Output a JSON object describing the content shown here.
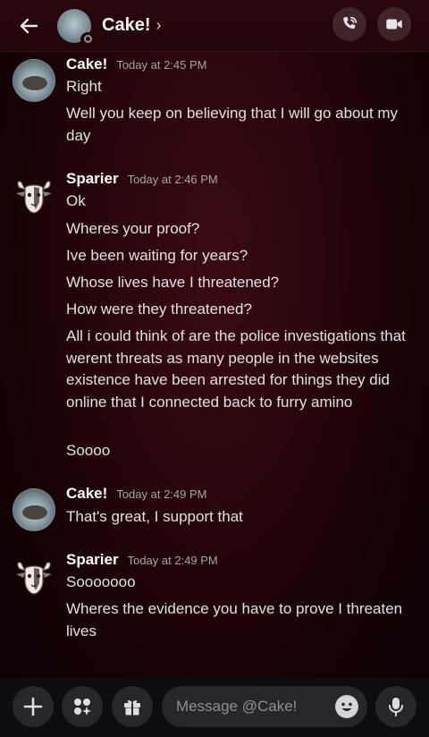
{
  "header": {
    "title": "Cake!",
    "chevron": "›",
    "back_icon": "arrow-left-icon",
    "call_icon": "phone-call-icon",
    "video_icon": "video-camera-icon"
  },
  "messages": [
    {
      "author": "Cake!",
      "time": "Today at 2:45 PM",
      "avatar": "cake",
      "lines": [
        "Right",
        "Well you keep on believing that I will go about my day"
      ]
    },
    {
      "author": "Sparier",
      "time": "Today at 2:46 PM",
      "avatar": "sparier",
      "lines": [
        "Ok",
        "Wheres your proof?",
        "Ive been waiting for years?",
        "Whose lives have I threatened?",
        "How were they threatened?",
        "All i could think of are the police investigations that werent threats as many people in the websites existence have been arrested for things they did online that I connected back to furry amino",
        "Soooo"
      ]
    },
    {
      "author": "Cake!",
      "time": "Today at 2:49 PM",
      "avatar": "cake",
      "lines": [
        "That's great, I support that"
      ]
    },
    {
      "author": "Sparier",
      "time": "Today at 2:49 PM",
      "avatar": "sparier",
      "lines": [
        "Sooooooo",
        "Wheres the evidence you have to prove I threaten lives"
      ]
    }
  ],
  "composer": {
    "placeholder": "Message @Cake!",
    "icons": [
      "plus-icon",
      "apps-icon",
      "gift-icon",
      "emoji-icon",
      "microphone-icon"
    ]
  },
  "colors": {
    "background": "#230509",
    "text": "#dfe1e5",
    "muted": "#a3a6aa",
    "composer": "#0c0d10",
    "control": "#26272c"
  }
}
